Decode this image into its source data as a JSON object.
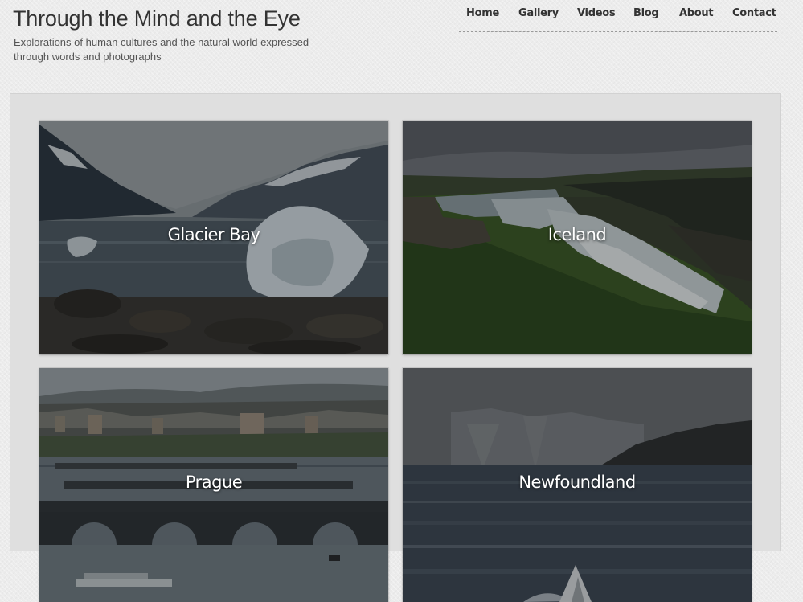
{
  "site": {
    "title": "Through the Mind and the Eye",
    "tagline": "Explorations of human cultures and the natural world expressed through words and photographs"
  },
  "nav": {
    "items": [
      {
        "label": "Home"
      },
      {
        "label": "Gallery"
      },
      {
        "label": "Videos"
      },
      {
        "label": "Blog"
      },
      {
        "label": "About"
      },
      {
        "label": "Contact"
      }
    ]
  },
  "gallery": {
    "tiles": [
      {
        "label": "Glacier Bay",
        "image": "glacier-photo"
      },
      {
        "label": "Iceland",
        "image": "waterfall-photo"
      },
      {
        "label": "Prague",
        "image": "bridge-city-photo"
      },
      {
        "label": "Newfoundland",
        "image": "coast-boat-photo"
      }
    ]
  }
}
